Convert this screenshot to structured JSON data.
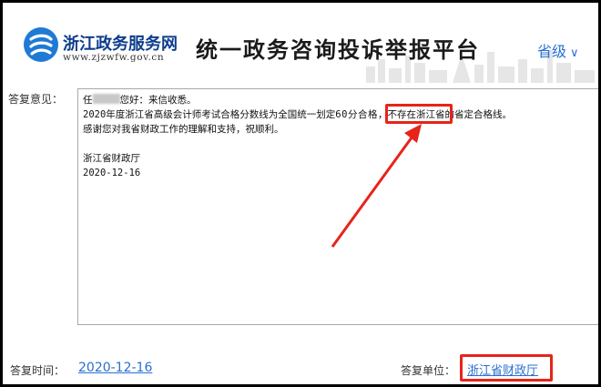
{
  "header": {
    "site_name": "浙江政务服务网",
    "site_url": "www.zjzwfw.gov.cn",
    "platform_title": "统一政务咨询投诉举报平台",
    "level_select": "省级"
  },
  "reply": {
    "label": "答复意见：",
    "greeting_prefix": "任",
    "greeting_suffix": "您好：来信收悉。",
    "line2_a": "2020年度浙江省高级会计师考试合格分数线为全国统一划定",
    "line2_b": "60分合格",
    "line2_c": "，不存在浙江省的省定合格线。",
    "line3": "感谢您对我省财政工作的理解和支持，祝顺利。",
    "signature": "浙江省财政厅",
    "date": "2020-12-16"
  },
  "footer": {
    "time_label": "答复时间：",
    "time_value": "2020-12-16",
    "unit_label": "答复单位：",
    "unit_value": "浙江省财政厅"
  },
  "colors": {
    "accent_blue": "#2a6fd1",
    "highlight_red": "#e8231a",
    "brand_navy": "#0e3d8c"
  }
}
